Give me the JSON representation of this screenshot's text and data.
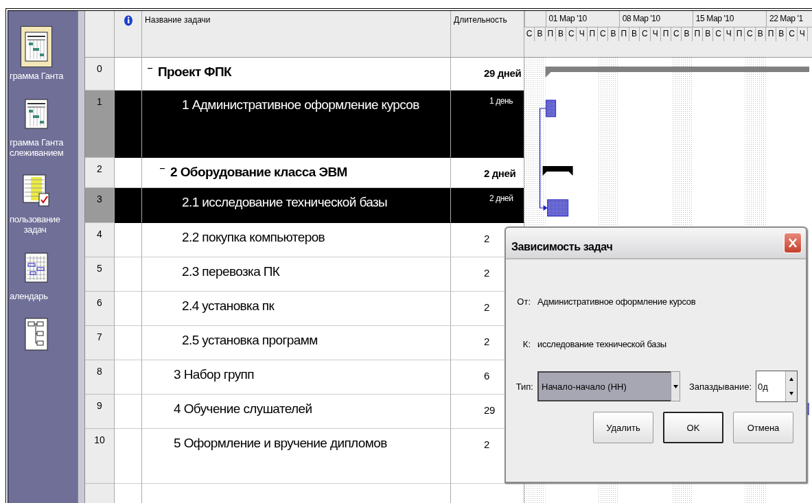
{
  "sidebar": {
    "items": [
      {
        "label": "грамма Ганта",
        "selected": true,
        "kind": "gantt"
      },
      {
        "label": "грамма Ганта\nслеживанием",
        "selected": false,
        "kind": "gantt"
      },
      {
        "label": "пользование\nзадач",
        "selected": false,
        "kind": "usage"
      },
      {
        "label": "алендарь",
        "selected": false,
        "kind": "calendar"
      },
      {
        "kind": "network",
        "selected": false
      }
    ]
  },
  "table": {
    "columns": {
      "name": "Название задачи",
      "duration": "Длительность"
    },
    "rows": [
      {
        "id": "0",
        "name": "Проект ФПК",
        "duration": "29 дней",
        "kind": "summary",
        "expanded": true,
        "selected": false,
        "children": [
          {
            "id": "1",
            "name": "1 Административное оформление курсов",
            "duration": "1 день",
            "kind": "task",
            "selected": true
          },
          {
            "id": "2",
            "name": "2 Оборудование класса ЭВМ",
            "duration": "2 дней",
            "kind": "summary",
            "expanded": true,
            "selected": false,
            "children": [
              {
                "id": "3",
                "name": "2.1 исследование технической базы",
                "duration": "2 дней",
                "kind": "task",
                "selected": true
              },
              {
                "id": "4",
                "name": "2.2 покупка компьютеров",
                "duration": "2",
                "kind": "task",
                "selected": false
              },
              {
                "id": "5",
                "name": "2.3 перевозка ПК",
                "duration": "2",
                "kind": "task",
                "selected": false
              },
              {
                "id": "6",
                "name": "2.4 установка пк",
                "duration": "2",
                "kind": "task",
                "selected": false
              },
              {
                "id": "7",
                "name": "2.5 установка программ",
                "duration": "2",
                "kind": "task",
                "selected": false
              }
            ]
          },
          {
            "id": "8",
            "name": "3 Набор групп",
            "duration": "6",
            "kind": "task",
            "selected": false
          },
          {
            "id": "9",
            "name": "4 Обучение слушателей",
            "duration": "29",
            "kind": "task",
            "selected": false
          },
          {
            "id": "10",
            "name": "5 Оформление и вручение дипломов",
            "duration": "2",
            "kind": "task",
            "selected": false
          }
        ]
      }
    ]
  },
  "timescale": {
    "weeks": [
      "01 Мар '10",
      "08 Мар '10",
      "15 Мар '10",
      "22 Мар '1"
    ],
    "days": [
      "С",
      "В",
      "П",
      "В",
      "С",
      "Ч",
      "П",
      "С",
      "В",
      "П",
      "В",
      "С",
      "Ч",
      "П",
      "С",
      "В",
      "П",
      "В",
      "С",
      "Ч",
      "П",
      "С",
      "В",
      "П",
      "В",
      "С",
      "Ч"
    ]
  },
  "dialog": {
    "title": "Зависимость задач",
    "from_label": "От:",
    "from": "Административное оформление курсов",
    "to_label": "К:",
    "to": "исследование технической базы",
    "type_label": "Тип:",
    "type": "Начало-начало (НН)",
    "lag_label": "Запаздывание:",
    "lag": "0д",
    "buttons": [
      {
        "label": "Удалить",
        "default": false
      },
      {
        "label": "OK",
        "default": true
      },
      {
        "label": "Отмена",
        "default": false
      }
    ]
  }
}
